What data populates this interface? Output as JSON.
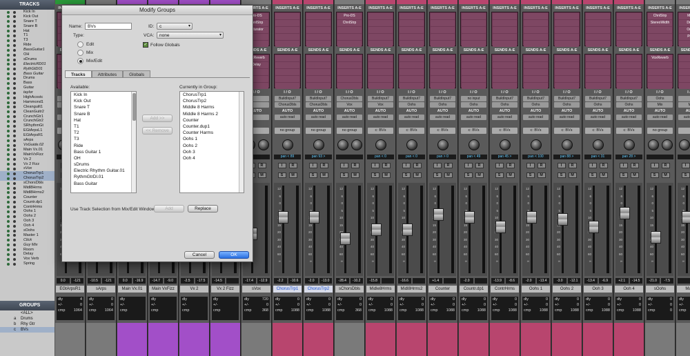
{
  "tracks_panel": {
    "title": "TRACKS",
    "items": [
      {
        "name": "Kick In",
        "italic": false,
        "selected": false
      },
      {
        "name": "Kick Out",
        "italic": false,
        "selected": false
      },
      {
        "name": "Snare T",
        "italic": false,
        "selected": false
      },
      {
        "name": "Snare B",
        "italic": false,
        "selected": false
      },
      {
        "name": "Hat",
        "italic": false,
        "selected": false
      },
      {
        "name": "T1",
        "italic": false,
        "selected": false
      },
      {
        "name": "T3",
        "italic": false,
        "selected": false
      },
      {
        "name": "Ride",
        "italic": false,
        "selected": false
      },
      {
        "name": "BassGuitar1",
        "italic": true,
        "selected": false
      },
      {
        "name": "OH",
        "italic": false,
        "selected": false
      },
      {
        "name": "sDrums",
        "italic": false,
        "selected": false
      },
      {
        "name": "ElectricRD01",
        "italic": true,
        "selected": false
      },
      {
        "name": "RythGtD01",
        "italic": true,
        "selected": false
      },
      {
        "name": "Bass Guitar",
        "italic": true,
        "selected": false
      },
      {
        "name": "Drums",
        "italic": false,
        "selected": false
      },
      {
        "name": "Bass",
        "italic": false,
        "selected": false
      },
      {
        "name": "Guitar",
        "italic": false,
        "selected": false
      },
      {
        "name": "taylor",
        "italic": true,
        "selected": false
      },
      {
        "name": "HighAcostc",
        "italic": false,
        "selected": false
      },
      {
        "name": "Hammond1",
        "italic": false,
        "selected": false
      },
      {
        "name": "Cleanguilt1",
        "italic": false,
        "selected": false
      },
      {
        "name": "CleanGuitr2",
        "italic": false,
        "selected": false
      },
      {
        "name": "CrunchGtr1",
        "italic": false,
        "selected": false
      },
      {
        "name": "CrunchGtr2",
        "italic": false,
        "selected": false
      },
      {
        "name": "SRhythmGt",
        "italic": false,
        "selected": false
      },
      {
        "name": "EGtArpsL1",
        "italic": false,
        "selected": false
      },
      {
        "name": "EGtArpsR1",
        "italic": false,
        "selected": false
      },
      {
        "name": "sArps",
        "italic": false,
        "selected": false
      },
      {
        "name": "VxGuide.02",
        "italic": true,
        "selected": false
      },
      {
        "name": "Main Vx.01",
        "italic": false,
        "selected": false
      },
      {
        "name": "MainVxFizz",
        "italic": false,
        "selected": false
      },
      {
        "name": "Vx 2",
        "italic": false,
        "selected": false
      },
      {
        "name": "Vx 2 Fizz",
        "italic": false,
        "selected": false
      },
      {
        "name": "sVox",
        "italic": true,
        "selected": false
      },
      {
        "name": "ChorusTrp1",
        "italic": false,
        "selected": true
      },
      {
        "name": "ChorusTrp2",
        "italic": false,
        "selected": true
      },
      {
        "name": "sChorsDbls",
        "italic": false,
        "selected": false
      },
      {
        "name": "Midl8Hrms",
        "italic": false,
        "selected": false
      },
      {
        "name": "Midl8Hrms2",
        "italic": false,
        "selected": false
      },
      {
        "name": "Counter",
        "italic": false,
        "selected": false
      },
      {
        "name": "Countr.dp1",
        "italic": false,
        "selected": false
      },
      {
        "name": "ContrHrms",
        "italic": false,
        "selected": false
      },
      {
        "name": "Oohs 1",
        "italic": false,
        "selected": false
      },
      {
        "name": "Oohs 2",
        "italic": false,
        "selected": false
      },
      {
        "name": "Ooh 3",
        "italic": false,
        "selected": false
      },
      {
        "name": "Ooh 4",
        "italic": false,
        "selected": false
      },
      {
        "name": "sOohs",
        "italic": false,
        "selected": false
      },
      {
        "name": "Master 1",
        "italic": false,
        "selected": false
      },
      {
        "name": "Click",
        "italic": true,
        "selected": false
      },
      {
        "name": "Guy Mix",
        "italic": true,
        "selected": false
      },
      {
        "name": "Room",
        "italic": false,
        "selected": false
      },
      {
        "name": "Delay",
        "italic": false,
        "selected": false
      },
      {
        "name": "Vox Verb",
        "italic": false,
        "selected": false
      },
      {
        "name": "Spring",
        "italic": false,
        "selected": false
      }
    ]
  },
  "groups_panel": {
    "title": "GROUPS",
    "items": [
      {
        "id": "",
        "name": "<ALL>",
        "selected": false
      },
      {
        "id": "a",
        "name": "Drums",
        "selected": false
      },
      {
        "id": "b",
        "name": "Rhy Gtr",
        "selected": false
      },
      {
        "id": "c",
        "name": "BVs",
        "selected": true
      }
    ]
  },
  "mixer": {
    "inserts_label": "INSERTS A-E",
    "sends_label": "SENDS A-E",
    "io_label": "I / O",
    "auto_label": "AUTO",
    "strips": [
      {
        "name": "EGtArpsR1",
        "top": "#2a9a3a",
        "bottom": "#7a7a7a",
        "inserts": [],
        "sends": [],
        "in": "",
        "out": "",
        "auto": "",
        "group": "",
        "pan": "",
        "vol": "0.0",
        "peak": "-121",
        "dly": "4",
        "pm": "0",
        "cmp": "1064",
        "fader": 0.68,
        "sel": false
      },
      {
        "name": "sArps",
        "top": "#7a7a7a",
        "bottom": "#7a7a7a",
        "inserts": [],
        "sends": [],
        "in": "",
        "out": "",
        "auto": "",
        "group": "",
        "pan": "",
        "vol": "-10.5",
        "peak": "-121",
        "dly": "0",
        "pm": "0",
        "cmp": "1064",
        "fader": 0.55,
        "sel": false
      },
      {
        "name": "Main Vx.01",
        "top": "#a24fc8",
        "bottom": "#a24fc8",
        "inserts": [],
        "sends": [],
        "in": "",
        "out": "",
        "auto": "",
        "group": "",
        "pan": "",
        "vol": "0.0",
        "peak": "-16.9",
        "dly": "",
        "pm": "",
        "cmp": "",
        "fader": 0.68,
        "sel": false
      },
      {
        "name": "Main VxFizz",
        "top": "#a24fc8",
        "bottom": "#a24fc8",
        "inserts": [],
        "sends": [],
        "in": "",
        "out": "",
        "auto": "",
        "group": "",
        "pan": "",
        "vol": "-14.7",
        "peak": "-9.0",
        "dly": "",
        "pm": "",
        "cmp": "",
        "fader": 0.5,
        "sel": false
      },
      {
        "name": "Vx 2",
        "top": "#a24fc8",
        "bottom": "#a24fc8",
        "inserts": [],
        "sends": [],
        "in": "",
        "out": "",
        "auto": "",
        "group": "",
        "pan": "",
        "vol": "-2.5",
        "peak": "-17.5",
        "dly": "",
        "pm": "",
        "cmp": "",
        "fader": 0.64,
        "sel": false
      },
      {
        "name": "Vx 2 Fizz",
        "top": "#a24fc8",
        "bottom": "#a24fc8",
        "inserts": [],
        "sends": [],
        "in": "",
        "out": "",
        "auto": "",
        "group": "",
        "pan": "",
        "vol": "-14.5",
        "peak": "",
        "dly": "",
        "pm": "",
        "cmp": "",
        "fader": 0.5,
        "sel": false
      },
      {
        "name": "sVox",
        "top": "#7a7a7a",
        "bottom": "#7a7a7a",
        "inserts": [
          "Pro-DS",
          "ChnlStrp",
          "Saturator"
        ],
        "sends": [
          "VoxReverb",
          "Delay"
        ],
        "in": "",
        "out": "",
        "auto": "",
        "group": "",
        "pan": "",
        "vol": "-17.4",
        "peak": "-12.9",
        "dly": "720",
        "pm": "0",
        "cmp": "368",
        "fader": 0.45,
        "sel": false
      },
      {
        "name": "ChorusTrp1",
        "top": "#b8456e",
        "bottom": "#b8456e",
        "inserts": [],
        "sends": [],
        "in": "BuildInput7",
        "out": "ChorusDbls",
        "auto": "auto read",
        "group": "no group",
        "pan": "pan  < 89",
        "vol": "-2.2",
        "peak": "-10.6",
        "dly": "0",
        "pm": "0",
        "cmp": "1088",
        "fader": 0.66,
        "sel": true
      },
      {
        "name": "ChorusTrp2",
        "top": "#b8456e",
        "bottom": "#b8456e",
        "inserts": [],
        "sends": [],
        "in": "BuildInput7",
        "out": "ChorusDbls",
        "auto": "auto read",
        "group": "no group",
        "pan": "pan  93 >",
        "vol": "-2.0",
        "peak": "-13.0",
        "dly": "0",
        "pm": "0",
        "cmp": "1088",
        "fader": 0.66,
        "sel": true
      },
      {
        "name": "sChorsDbls",
        "top": "#7a7a7a",
        "bottom": "#7a7a7a",
        "inserts": [
          "Pro-DS",
          "ChnlStrp"
        ],
        "sends": [],
        "in": "ChorusDbls",
        "out": "Vox",
        "auto": "auto read",
        "group": "no group",
        "pan": "",
        "vol": "-28.4",
        "peak": "-10.2",
        "dly": "0",
        "pm": "0",
        "cmp": "368",
        "fader": 0.38,
        "sel": false
      },
      {
        "name": "Midle8Hrms",
        "top": "#b8456e",
        "bottom": "#b8456e",
        "inserts": [],
        "sends": [],
        "in": "BuildInput7",
        "out": "Vox",
        "auto": "auto read",
        "group": "c: BVs",
        "pan": "pan  < 0",
        "vol": "-15.8",
        "peak": "",
        "dly": "0",
        "pm": "0",
        "cmp": "1088",
        "fader": 0.5,
        "sel": false
      },
      {
        "name": "Midl8Hrms2",
        "top": "#b8456e",
        "bottom": "#b8456e",
        "inserts": [],
        "sends": [],
        "in": "BuildInput7",
        "out": "Oohs",
        "auto": "auto read",
        "group": "c: BVs",
        "pan": "pan  < 0",
        "vol": "-16.6",
        "peak": "",
        "dly": "0",
        "pm": "0",
        "cmp": "1088",
        "fader": 0.5,
        "sel": false
      },
      {
        "name": "Counter",
        "top": "#b8456e",
        "bottom": "#b8456e",
        "inserts": [],
        "sends": [],
        "in": "BuildInput7",
        "out": "Oohs",
        "auto": "auto read",
        "group": "c: BVs",
        "pan": "pan  > 0",
        "vol": "+1.4",
        "peak": "",
        "dly": "0",
        "pm": "0",
        "cmp": "1088",
        "fader": 0.7,
        "sel": false
      },
      {
        "name": "Countr.dp1",
        "top": "#b8456e",
        "bottom": "#b8456e",
        "inserts": [],
        "sends": [],
        "in": "no input",
        "out": "Oohs",
        "auto": "auto read",
        "group": "c: BVs",
        "pan": "pan  < 49",
        "vol": "-2.0",
        "peak": "",
        "dly": "0",
        "pm": "0",
        "cmp": "1088",
        "fader": 0.66,
        "sel": false
      },
      {
        "name": "ContrHrms",
        "top": "#b8456e",
        "bottom": "#b8456e",
        "inserts": [],
        "sends": [],
        "in": "BuildInput7",
        "out": "Oohs",
        "auto": "auto read",
        "group": "c: BVs",
        "pan": "pan  45 >",
        "vol": "-13.9",
        "peak": "-8.6",
        "dly": "0",
        "pm": "0",
        "cmp": "1088",
        "fader": 0.54,
        "sel": false
      },
      {
        "name": "Oohs 1",
        "top": "#b8456e",
        "bottom": "#b8456e",
        "inserts": [],
        "sends": [],
        "in": "BuildInput7",
        "out": "Oohs",
        "auto": "auto read",
        "group": "c: BVs",
        "pan": "pan  < 100",
        "vol": "-2.0",
        "peak": "-13.4",
        "dly": "0",
        "pm": "0",
        "cmp": "1088",
        "fader": 0.66,
        "sel": false
      },
      {
        "name": "Oohs 2",
        "top": "#b8456e",
        "bottom": "#b8456e",
        "inserts": [],
        "sends": [],
        "in": "BuildInput7",
        "out": "Oohs",
        "auto": "auto read",
        "group": "c: BVs",
        "pan": "pan  88 >",
        "vol": "-3.0",
        "peak": "-12.1",
        "dly": "0",
        "pm": "0",
        "cmp": "1088",
        "fader": 0.64,
        "sel": false
      },
      {
        "name": "Ooh 3",
        "top": "#b8456e",
        "bottom": "#b8456e",
        "inserts": [],
        "sends": [],
        "in": "BuildInput7",
        "out": "Oohs",
        "auto": "auto read",
        "group": "c: BVs",
        "pan": "pan  < 31",
        "vol": "-13.4",
        "peak": "-6.9",
        "dly": "0",
        "pm": "0",
        "cmp": "1088",
        "fader": 0.54,
        "sel": false
      },
      {
        "name": "Ooh 4",
        "top": "#b8456e",
        "bottom": "#b8456e",
        "inserts": [],
        "sends": [],
        "in": "BuildInput7",
        "out": "Oohs",
        "auto": "auto read",
        "group": "c: BVs",
        "pan": "pan  28 >",
        "vol": "+2.1",
        "peak": "-14.5",
        "dly": "0",
        "pm": "0",
        "cmp": "1088",
        "fader": 0.72,
        "sel": false
      },
      {
        "name": "sOohs",
        "top": "#7a7a7a",
        "bottom": "#7a7a7a",
        "inserts": [
          "ChnlStrp",
          "StereoWidth"
        ],
        "sends": [
          "VoxReverb"
        ],
        "in": "Oohs",
        "out": "Mix",
        "auto": "auto read",
        "group": "no group",
        "pan": "",
        "vol": "-21.0",
        "peak": "-7.5",
        "dly": "0",
        "pm": "0",
        "cmp": "0",
        "fader": 0.4,
        "sel": false
      },
      {
        "name": "Maste",
        "top": "#7a7a7a",
        "bottom": "#7a7a7a",
        "inserts": [
          "Mast",
          "Drum",
          "On Ib",
          "ProL"
        ],
        "sends": [],
        "in": "",
        "out": "Mix",
        "auto": "auto read",
        "group": "",
        "pan": "",
        "vol": "",
        "peak": "",
        "dly": "",
        "pm": "",
        "cmp": "",
        "fader": 0.66,
        "sel": false
      }
    ]
  },
  "dialog": {
    "title": "Modify Groups",
    "name_label": "Name:",
    "name_value": "BVs",
    "id_label": "ID:",
    "id_value": "c",
    "type_label": "Type:",
    "type_options": [
      "Edit",
      "Mix",
      "Mix/Edit"
    ],
    "type_selected": 2,
    "vca_label": "VCA:",
    "vca_value": "none",
    "follow_globals_label": "Follow Globals",
    "tabs": [
      "Tracks",
      "Attributes",
      "Globals"
    ],
    "available_label": "Available:",
    "available": [
      "Kick In",
      "Kick Out",
      "Snare T",
      "Snare B",
      "Hat",
      "T1",
      "T2",
      "T3",
      "Ride",
      "Bass Guitar 1",
      "OH",
      "sDrums",
      "Electric Rhythm Guitar.01",
      "RythmGtrDl.01",
      "Bass Guitar"
    ],
    "add_button": "Add >>",
    "remove_button": "<< Remove",
    "current_label": "Currently in Group:",
    "current": [
      "ChorusTrp1",
      "ChorusTrp2",
      "Middle 8 Harms",
      "Middle 8 Harms 2",
      "Counter",
      "Counter.dup1",
      "Counter Harms",
      "Oohs 1",
      "Oohs 2",
      "Ooh 3",
      "Ooh 4"
    ],
    "selection_label": "Use Track Selection from Mix/Edit Window:",
    "add_sel_button": "Add",
    "replace_button": "Replace",
    "cancel_button": "Cancel",
    "ok_button": "OK"
  }
}
